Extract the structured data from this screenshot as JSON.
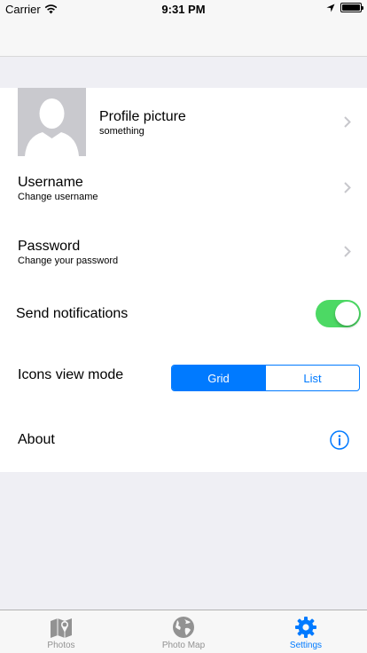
{
  "status_bar": {
    "carrier": "Carrier",
    "time": "9:31 PM"
  },
  "settings": {
    "profile": {
      "title": "Profile picture",
      "subtitle": "something"
    },
    "username": {
      "title": "Username",
      "subtitle": "Change username"
    },
    "password": {
      "title": "Password",
      "subtitle": "Change your password"
    },
    "notifications": {
      "label": "Send notifications",
      "enabled": true
    },
    "view_mode": {
      "label": "Icons view mode",
      "options": [
        "Grid",
        "List"
      ],
      "selected": "Grid"
    },
    "about": {
      "label": "About"
    }
  },
  "tab_bar": {
    "tabs": [
      {
        "label": "Photos",
        "icon": "map-pin-icon"
      },
      {
        "label": "Photo Map",
        "icon": "globe-icon"
      },
      {
        "label": "Settings",
        "icon": "gear-icon"
      }
    ],
    "active": "Settings"
  },
  "colors": {
    "accent": "#007aff",
    "switch_on": "#4cd964",
    "background": "#efeff4",
    "inactive_tab": "#929292"
  }
}
